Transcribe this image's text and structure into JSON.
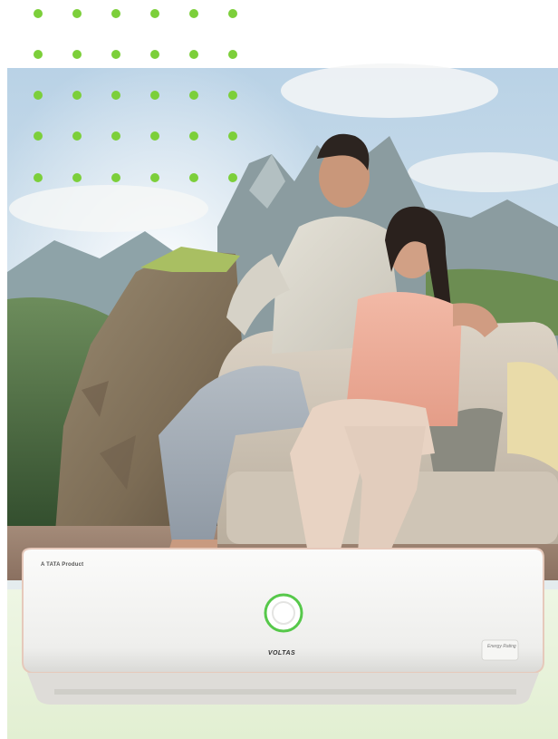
{
  "image": {
    "subject": "Couple sitting on a sofa in front of a mountain landscape, with a white split air conditioner in the foreground",
    "colors": {
      "dot_green": "#7ccf3a",
      "sky": "#c9dcea",
      "ac_white": "#f3f3f2",
      "ac_ring": "#56c84a",
      "ac_trim": "#e2b6a4",
      "bottom_glow": "#e8f3da"
    }
  },
  "ac_unit": {
    "tag_line": "A TATA Product",
    "brand": "VOLTAS",
    "badge": "Energy Rating"
  }
}
